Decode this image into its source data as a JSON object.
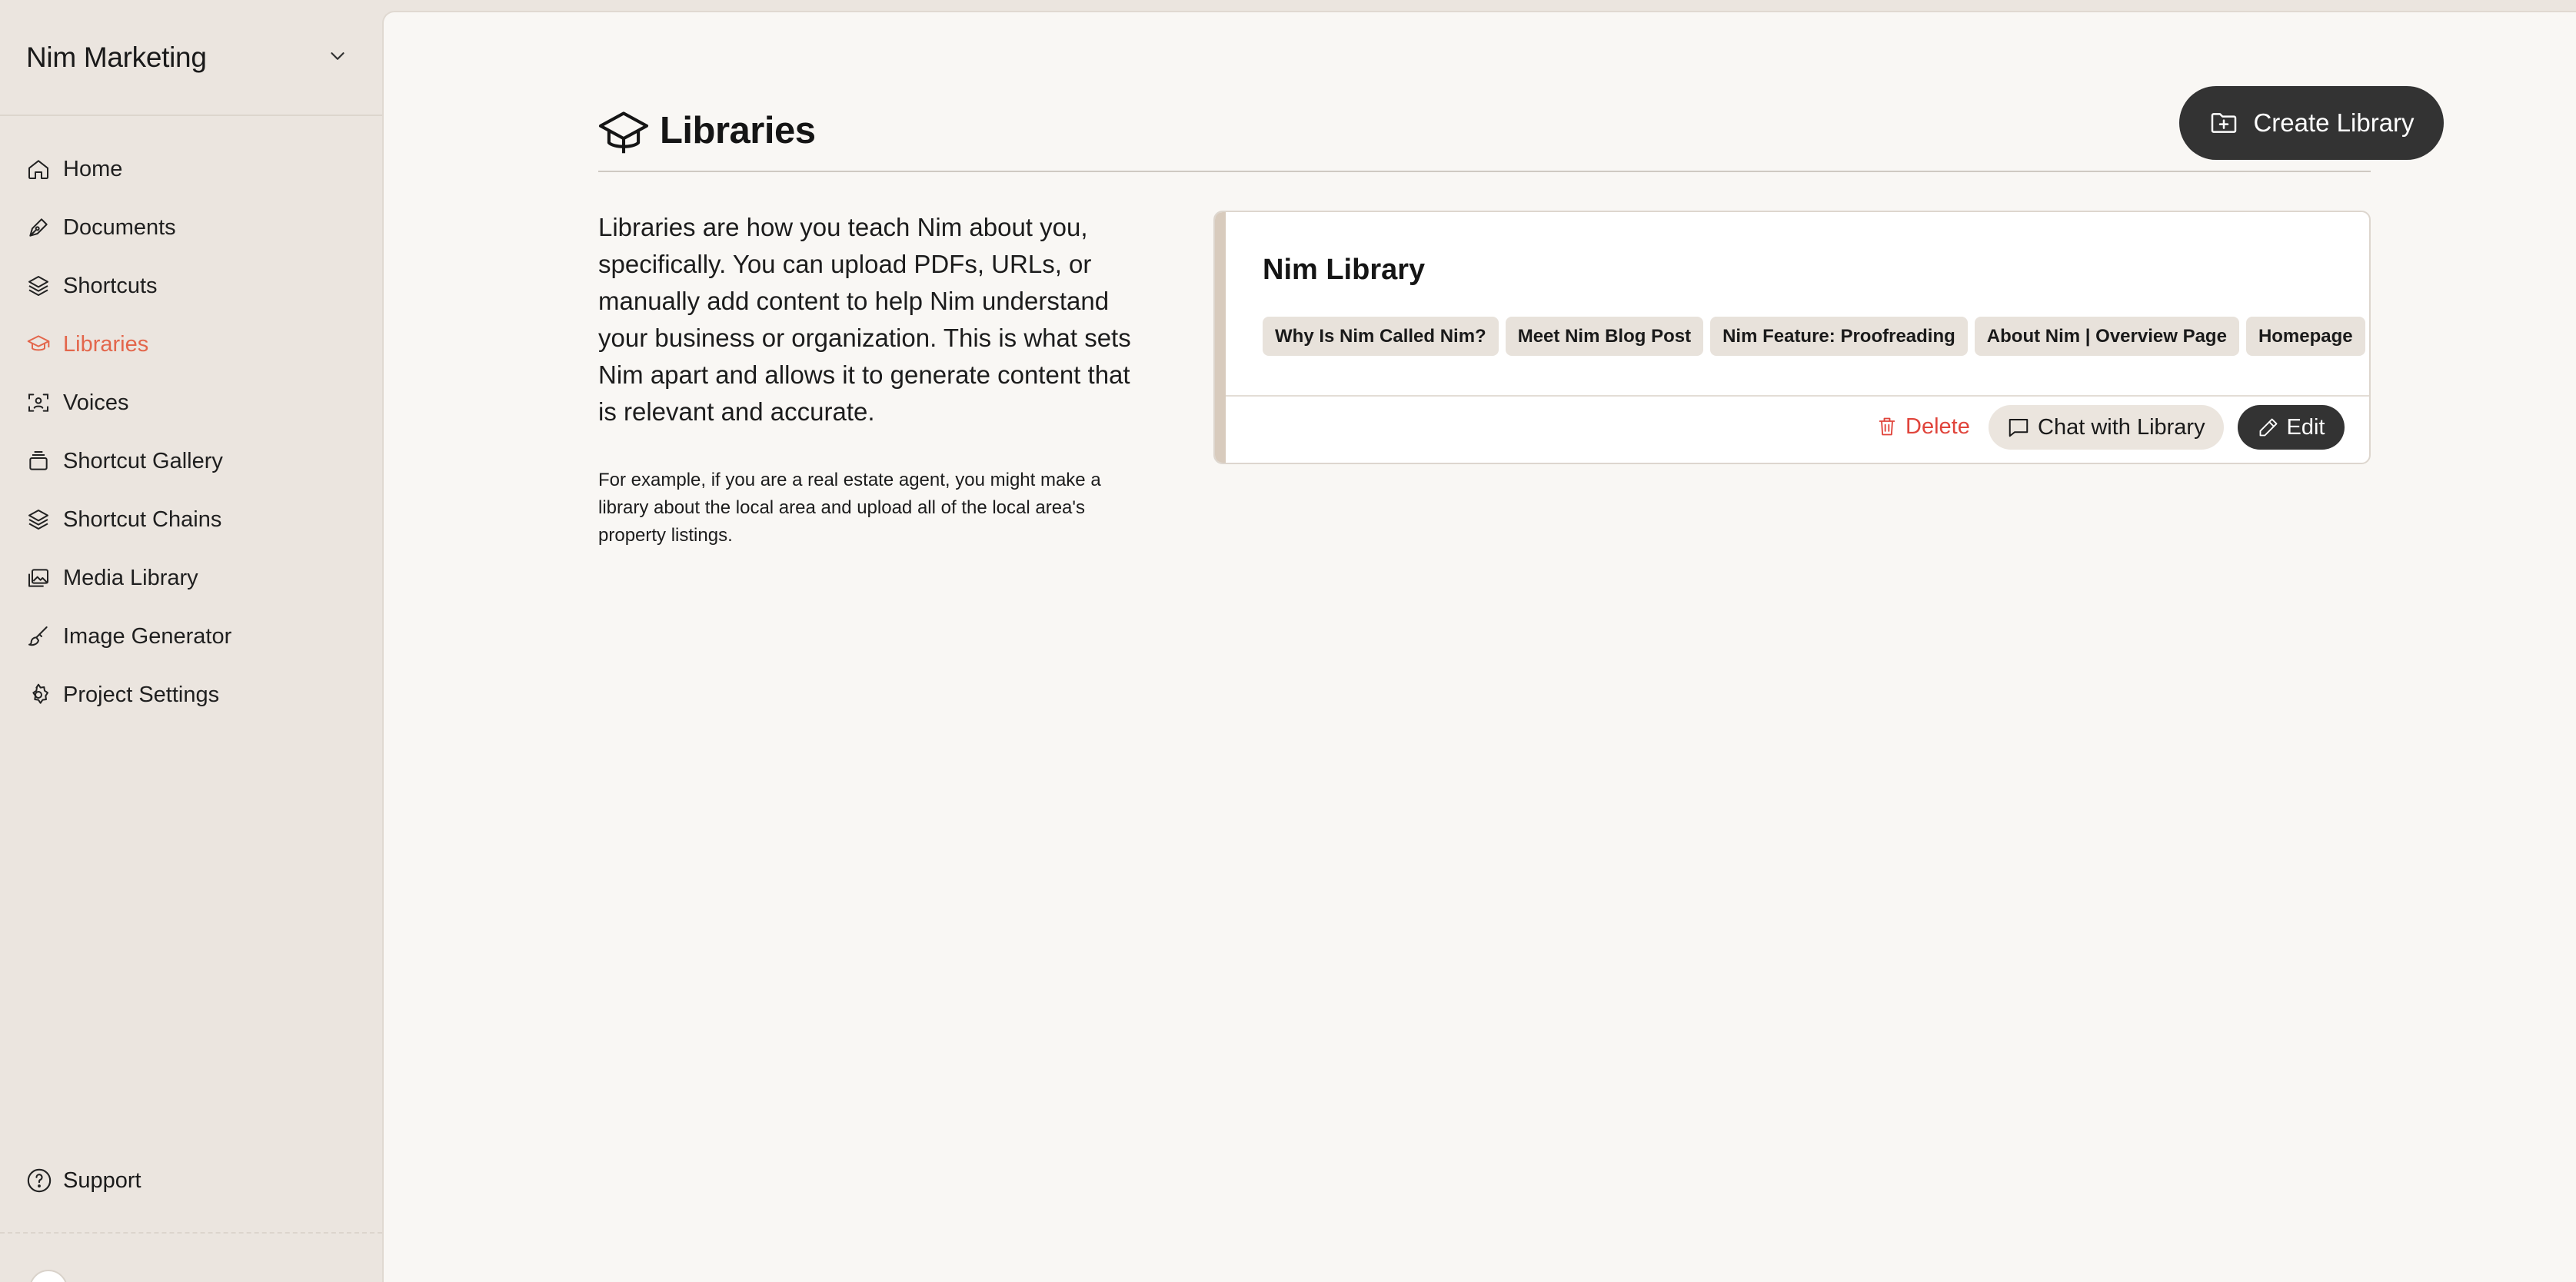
{
  "sidebar": {
    "org_name": "Nim Marketing",
    "items": [
      {
        "label": "Home",
        "icon": "home-icon"
      },
      {
        "label": "Documents",
        "icon": "pen-icon"
      },
      {
        "label": "Shortcuts",
        "icon": "layers-icon"
      },
      {
        "label": "Libraries",
        "icon": "graduation-cap-icon",
        "active": true
      },
      {
        "label": "Voices",
        "icon": "voice-scan-icon"
      },
      {
        "label": "Shortcut Gallery",
        "icon": "gallery-stack-icon"
      },
      {
        "label": "Shortcut Chains",
        "icon": "layers-icon"
      },
      {
        "label": "Media Library",
        "icon": "images-icon"
      },
      {
        "label": "Image Generator",
        "icon": "brush-icon"
      },
      {
        "label": "Project Settings",
        "icon": "gear-icon"
      }
    ],
    "support_label": "Support"
  },
  "page": {
    "title": "Libraries",
    "create_label": "Create Library",
    "intro": "Libraries are how you teach Nim about you, specifically. You can upload PDFs, URLs, or manually add content to help Nim understand your business or organization. This is what sets Nim apart and allows it to generate content that is relevant and accurate.",
    "example": "For example, if you are a real estate agent, you might make a library about the local area and upload all of the local area's property listings."
  },
  "library": {
    "name": "Nim Library",
    "sources": [
      "Why Is Nim Called Nim?",
      "Meet Nim Blog Post",
      "Nim Feature: Proofreading",
      "About Nim | Overview Page",
      "Homepage"
    ],
    "delete_label": "Delete",
    "chat_label": "Chat with Library",
    "edit_label": "Edit"
  },
  "colors": {
    "accent": "#e3664b",
    "danger": "#e0443b",
    "dark_button": "#333333",
    "sidebar_bg": "#ebe5df",
    "main_bg": "#f9f7f4"
  }
}
